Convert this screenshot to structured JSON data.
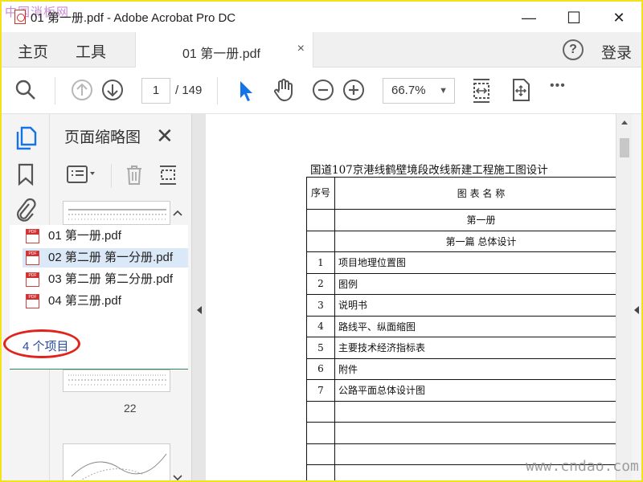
{
  "window": {
    "watermark_top": "中国消板网",
    "title": "01 第一册.pdf - Adobe Acrobat Pro DC",
    "minimize": "—",
    "maximize": "☐",
    "close": "✕"
  },
  "menubar": {
    "home": "主页",
    "tools": "工具",
    "tab_label": "01 第一册.pdf",
    "tab_close": "×",
    "help": "?",
    "login": "登录"
  },
  "toolbar": {
    "current_page": "1",
    "total_pages": "/ 149",
    "zoom": "66.7%",
    "zoom_caret": "▼",
    "more": "•••"
  },
  "thumbnail_panel": {
    "title": "页面缩略图",
    "close": "✕",
    "page_number": "22"
  },
  "file_list": {
    "files": [
      "01 第一册.pdf",
      "02 第二册 第一分册.pdf",
      "03 第二册 第二分册.pdf",
      "04 第三册.pdf"
    ],
    "selected_index": 1,
    "count": "4 个项目"
  },
  "document": {
    "title": "国道107京港线鹤壁境段改线新建工程施工图设计",
    "header_no": "序号",
    "header_name": "图 表 名 称",
    "volume": "第一册",
    "chapter": "第一篇  总体设计",
    "rows": [
      {
        "no": "1",
        "name": "项目地理位置图"
      },
      {
        "no": "2",
        "name": "图例"
      },
      {
        "no": "3",
        "name": "说明书"
      },
      {
        "no": "4",
        "name": "路线平、纵面缩图"
      },
      {
        "no": "5",
        "name": "主要技术经济指标表"
      },
      {
        "no": "6",
        "name": "附件"
      },
      {
        "no": "7",
        "name": "公路平面总体设计图"
      }
    ]
  },
  "watermark_bottom": "www.cndao.com",
  "colors": {
    "accent": "#1473e6",
    "highlight_ellipse": "#e0241b",
    "selection": "#dbe8f7",
    "frame": "#f2e21c"
  }
}
